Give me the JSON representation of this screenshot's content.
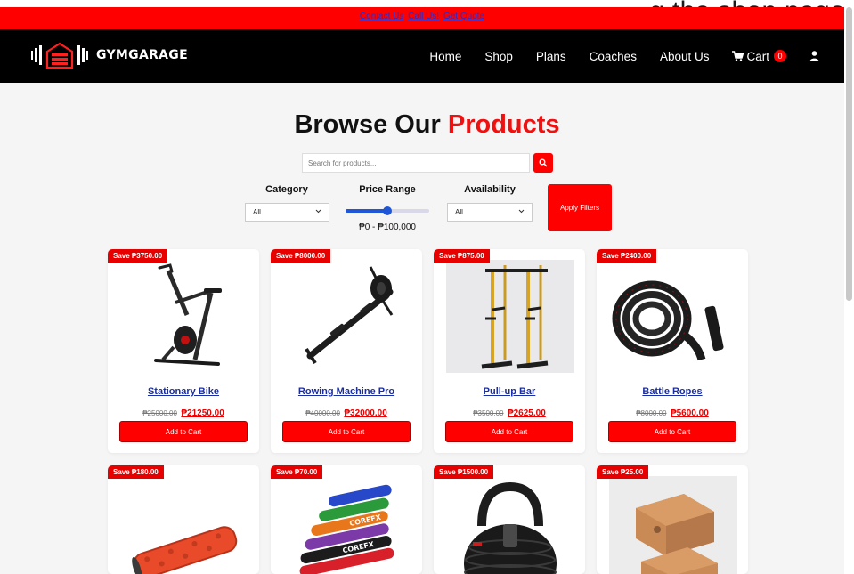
{
  "page_caption": "g the shop page",
  "topbar": {
    "links": [
      "Contact Us",
      "Call Us!",
      "Get Quote"
    ]
  },
  "navbar": {
    "brand": "GYMGARAGE",
    "links": [
      "Home",
      "Shop",
      "Plans",
      "Coaches",
      "About Us"
    ],
    "cart_label": "Cart",
    "cart_count": "0",
    "icons": [
      "gym-garage-logo-icon",
      "cart-icon",
      "user-icon"
    ]
  },
  "heading": {
    "part1": "Browse Our",
    "part2": "Products"
  },
  "search": {
    "placeholder": "Search for products..."
  },
  "filters": {
    "category_label": "Category",
    "category_value": "All",
    "price_label": "Price Range",
    "price_range_text": "₱0 - ₱100,000",
    "price_slider_value": 100000,
    "price_slider_max": 200000,
    "availability_label": "Availability",
    "availability_value": "All",
    "apply_label": "Apply Filters"
  },
  "products": [
    {
      "save": "Save ₱3750.00",
      "name": "Stationary Bike",
      "old_price": "₱25000.00",
      "new_price": "₱21250.00",
      "button": "Add to Cart",
      "image": "stationary-bike"
    },
    {
      "save": "Save ₱8000.00",
      "name": "Rowing Machine Pro",
      "old_price": "₱40000.00",
      "new_price": "₱32000.00",
      "button": "Add to Cart",
      "image": "rowing-machine"
    },
    {
      "save": "Save ₱875.00",
      "name": "Pull-up Bar",
      "old_price": "₱3500.00",
      "new_price": "₱2625.00",
      "button": "Add to Cart",
      "image": "pull-up-bar"
    },
    {
      "save": "Save ₱2400.00",
      "name": "Battle Ropes",
      "old_price": "₱8000.00",
      "new_price": "₱5600.00",
      "button": "Add to Cart",
      "image": "battle-ropes"
    },
    {
      "save": "Save ₱180.00",
      "image": "foam-roller"
    },
    {
      "save": "Save ₱70.00",
      "image": "resistance-bands",
      "band_text": "COREFX"
    },
    {
      "save": "Save ₱1500.00",
      "image": "adjustable-kettlebell"
    },
    {
      "save": "Save ₱25.00",
      "image": "cork-yoga-blocks"
    }
  ],
  "colors": {
    "accent": "#ff0000",
    "navbar": "#000000",
    "link": "#1a2ea0",
    "slider": "#1f56d8"
  }
}
